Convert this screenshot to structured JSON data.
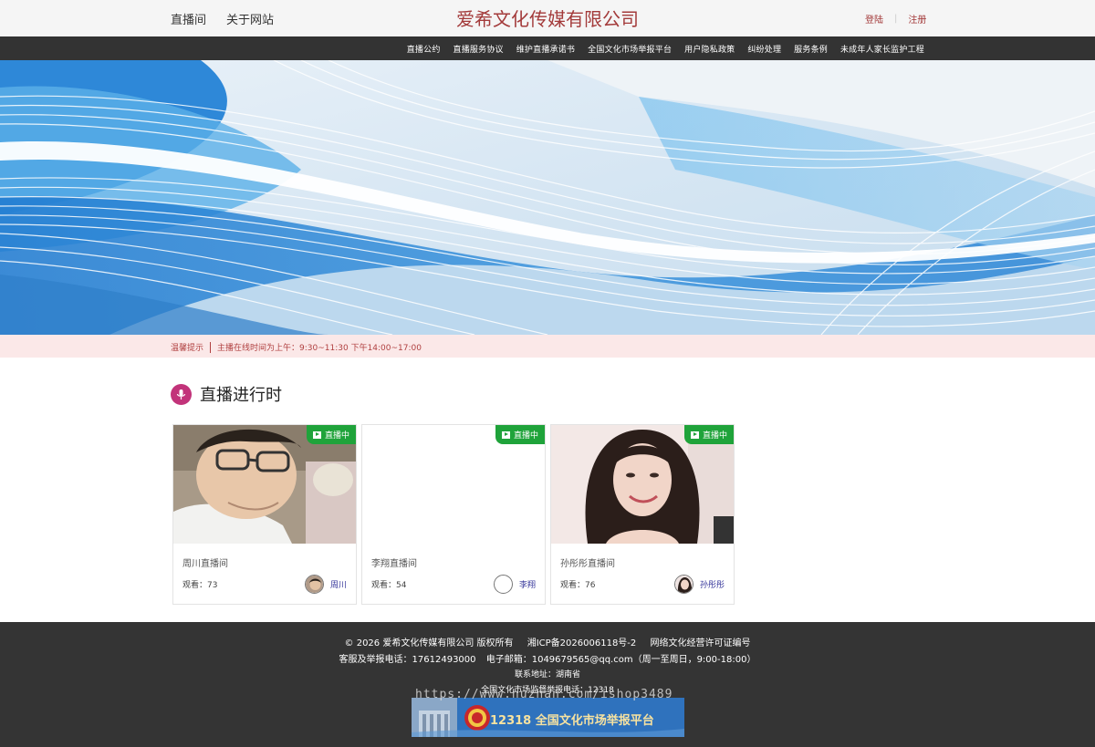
{
  "topbar": {
    "nav_left": [
      "直播间",
      "关于网站"
    ],
    "brand": "爱希文化传媒有限公司",
    "login": "登陆",
    "separator": "|",
    "register": "注册"
  },
  "navbar": {
    "items": [
      "直播公约",
      "直播服务协议",
      "维护直播承诺书",
      "全国文化市场举报平台",
      "用户隐私政策",
      "纠纷处理",
      "服务条例",
      "未成年人家长监护工程"
    ]
  },
  "notice": {
    "label": "温馨提示",
    "text": "主播在线时间为上午：9:30~11:30  下午14:00~17:00"
  },
  "section": {
    "title": "直播进行时"
  },
  "rooms": [
    {
      "badge": "直播中",
      "name": "周川直播间",
      "views_label": "观看：73",
      "anchor": "周川"
    },
    {
      "badge": "直播中",
      "name": "李翔直播间",
      "views_label": "观看：54",
      "anchor": "李翔"
    },
    {
      "badge": "直播中",
      "name": "孙彤彤直播间",
      "views_label": "观看：76",
      "anchor": "孙彤彤"
    }
  ],
  "footer": {
    "copyright": "© 2026 爱希文化传媒有限公司  版权所有",
    "icp": "湘ICP备2026006118号-2",
    "license": "网络文化经营许可证编号",
    "phone": "客服及举报电话：17612493000",
    "email": "电子邮箱：1049679565@qq.com（周一至周日，9:00-18:00）",
    "address": "联系地址：湖南省",
    "hotline": "全国文化市场监督举报电话：12318",
    "platform_label": "12318 全国文化市场举报平台",
    "watermark": "https://www.huzhan.com/ishop3489"
  },
  "colors": {
    "brand_red": "#a33a3a",
    "nav_dark": "#333333",
    "live_green": "#1fa33a",
    "notice_bg": "#fbe8e8",
    "section_icon": "#c2337a",
    "footer_bg": "#343434"
  }
}
